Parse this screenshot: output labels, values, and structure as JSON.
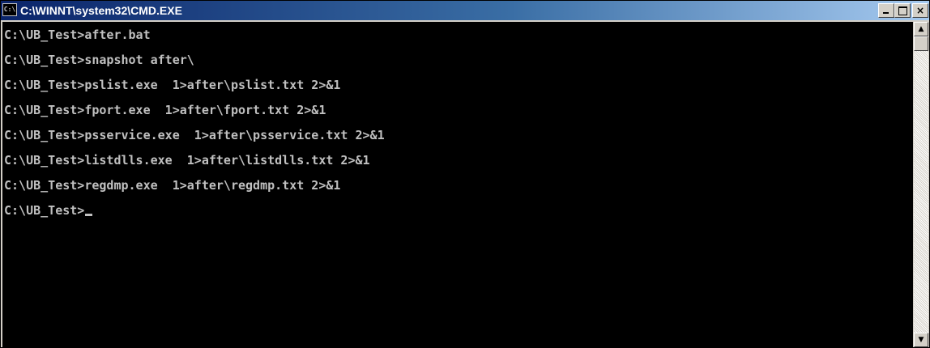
{
  "window": {
    "title": "C:\\WINNT\\system32\\CMD.EXE",
    "icon": "cmd-icon",
    "icon_text": "C:\\"
  },
  "caption_buttons": {
    "minimize_icon": "minimize-icon",
    "maximize_icon": "maximize-icon",
    "close_icon": "close-icon",
    "close_glyph": "×"
  },
  "console": {
    "lines": [
      "C:\\UB_Test>after.bat",
      "C:\\UB_Test>snapshot after\\",
      "C:\\UB_Test>pslist.exe  1>after\\pslist.txt 2>&1",
      "C:\\UB_Test>fport.exe  1>after\\fport.txt 2>&1",
      "C:\\UB_Test>psservice.exe  1>after\\psservice.txt 2>&1",
      "C:\\UB_Test>listdlls.exe  1>after\\listdlls.txt 2>&1",
      "C:\\UB_Test>regdmp.exe  1>after\\regdmp.txt 2>&1",
      "C:\\UB_Test>"
    ],
    "background": "#000000",
    "foreground": "#c0c0c0"
  },
  "scrollbar": {
    "up_glyph": "▲",
    "down_glyph": "▼"
  },
  "colors": {
    "titlebar_start": "#0a246a",
    "titlebar_end": "#a6caf0",
    "chrome": "#d4d0c8"
  }
}
